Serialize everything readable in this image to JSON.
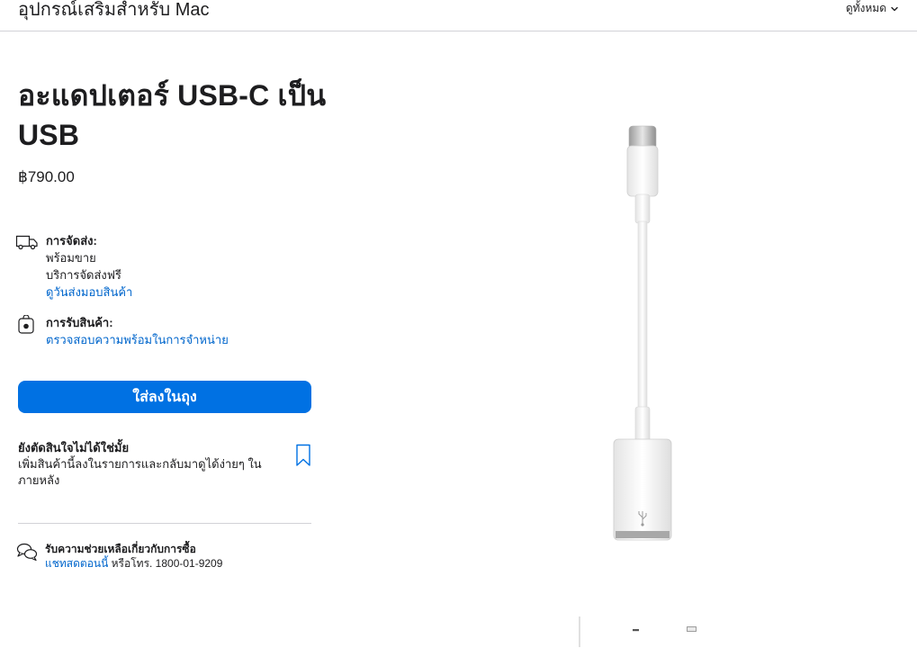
{
  "header": {
    "title": "อุปกรณ์เสริมสำหรับ Mac",
    "view_all": "ดูทั้งหมด",
    "chevron_icon": "chevron-down-icon"
  },
  "product": {
    "title": "อะแดปเตอร์ USB-C เป็น USB",
    "price": "฿790.00"
  },
  "delivery": {
    "icon": "truck-icon",
    "heading": "การจัดส่ง:",
    "line1": "พร้อมขาย",
    "line2": "บริการจัดส่งฟรี",
    "link": "ดูวันส่งมอบสินค้า"
  },
  "pickup": {
    "icon": "store-bag-icon",
    "heading": "การรับสินค้า:",
    "link": "ตรวจสอบความพร้อมในการจำหน่าย"
  },
  "add_to_bag": "ใส่ลงในถุง",
  "save_for_later": {
    "heading": "ยังตัดสินใจไม่ได้ใช่มั้ย",
    "text": "เพิ่มสินค้านี้ลงในรายการและกลับมาดูได้ง่ายๆ ในภายหลัง",
    "icon": "bookmark-icon"
  },
  "help": {
    "icon": "chat-bubbles-icon",
    "heading": "รับความช่วยเหลือเกี่ยวกับการซื้อ",
    "link": "แชทสดตอนนี้",
    "phone_text": " หรือโทร. 1800-01-9209"
  },
  "colors": {
    "accent": "#0071e3",
    "link": "#0066cc",
    "text": "#1d1d1f",
    "divider": "#d2d2d7"
  }
}
